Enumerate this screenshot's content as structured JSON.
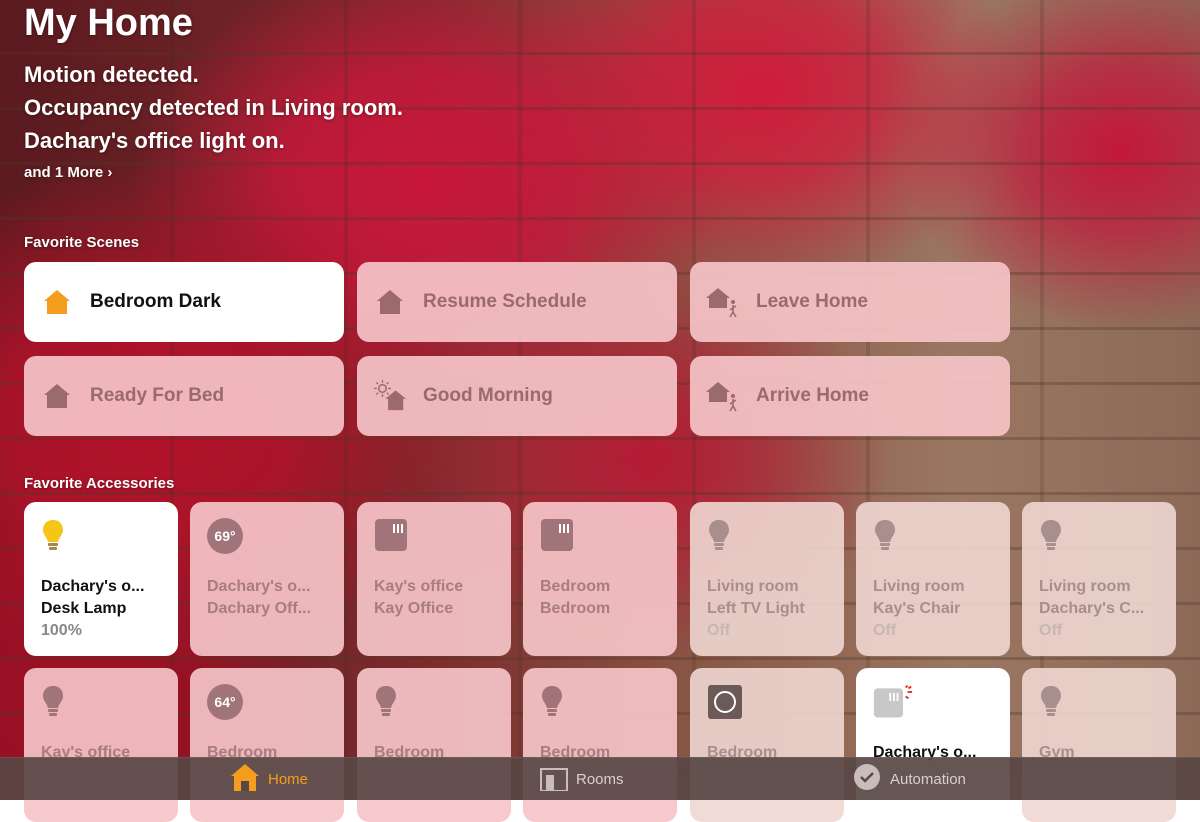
{
  "header": {
    "title": "My Home",
    "status_lines": [
      "Motion detected.",
      "Occupancy detected in Living room.",
      "Dachary's office light on."
    ],
    "more_link": "and 1 More ›"
  },
  "scenes": {
    "section_label": "Favorite Scenes",
    "items": [
      {
        "label": "Bedroom Dark",
        "icon": "home-icon",
        "active": true
      },
      {
        "label": "Resume Schedule",
        "icon": "home-icon",
        "active": false
      },
      {
        "label": "Leave Home",
        "icon": "home-person-icon",
        "active": false
      },
      {
        "label": "Ready For Bed",
        "icon": "home-icon",
        "active": false
      },
      {
        "label": "Good Morning",
        "icon": "home-sun-icon",
        "active": false
      },
      {
        "label": "Arrive Home",
        "icon": "home-person-icon",
        "active": false
      }
    ]
  },
  "accessories": {
    "section_label": "Favorite Accessories",
    "items": [
      {
        "line1": "Dachary's o...",
        "line2": "Desk Lamp",
        "line3": "100%",
        "icon": "lightbulb-on-icon",
        "state": "on"
      },
      {
        "line1": "Dachary's o...",
        "line2": "Dachary Off...",
        "line3": "",
        "icon": "thermostat-icon",
        "badge": "69°",
        "state": "pink"
      },
      {
        "line1": "Kay's office",
        "line2": "Kay Office",
        "line3": "",
        "icon": "switch-icon",
        "state": "pink"
      },
      {
        "line1": "Bedroom",
        "line2": "Bedroom",
        "line3": "",
        "icon": "switch-icon",
        "state": "pink"
      },
      {
        "line1": "Living room",
        "line2": "Left TV Light",
        "line3": "Off",
        "icon": "lightbulb-icon",
        "state": "neutral"
      },
      {
        "line1": "Living room",
        "line2": "Kay's Chair",
        "line3": "Off",
        "icon": "lightbulb-icon",
        "state": "neutral"
      },
      {
        "line1": "Living room",
        "line2": "Dachary's C...",
        "line3": "Off",
        "icon": "lightbulb-icon",
        "state": "neutral"
      },
      {
        "line1": "Kay's office",
        "line2": "",
        "line3": "",
        "icon": "lightbulb-icon",
        "state": "pink"
      },
      {
        "line1": "Bedroom",
        "line2": "",
        "line3": "",
        "icon": "thermostat-icon",
        "badge": "64°",
        "state": "pink"
      },
      {
        "line1": "Bedroom",
        "line2": "",
        "line3": "",
        "icon": "lightbulb-icon",
        "state": "pink"
      },
      {
        "line1": "Bedroom",
        "line2": "",
        "line3": "",
        "icon": "lightbulb-icon",
        "state": "pink"
      },
      {
        "line1": "Bedroom",
        "line2": "",
        "line3": "",
        "icon": "sensor-icon",
        "state": "neutral"
      },
      {
        "line1": "Dachary's o...",
        "line2": "",
        "line3": "",
        "icon": "motion-switch-icon",
        "state": "on"
      },
      {
        "line1": "Gym",
        "line2": "",
        "line3": "",
        "icon": "lightbulb-icon",
        "state": "neutral"
      }
    ]
  },
  "tabbar": {
    "tabs": [
      {
        "label": "Home",
        "icon": "home-icon",
        "selected": true
      },
      {
        "label": "Rooms",
        "icon": "rooms-icon",
        "selected": false
      },
      {
        "label": "Automation",
        "icon": "automation-icon",
        "selected": false
      }
    ]
  },
  "colors": {
    "accent": "#f59d1c",
    "tile_pink": "#f5c4c8",
    "tile_on": "#ffffff",
    "bulb_on": "#f5c518"
  }
}
